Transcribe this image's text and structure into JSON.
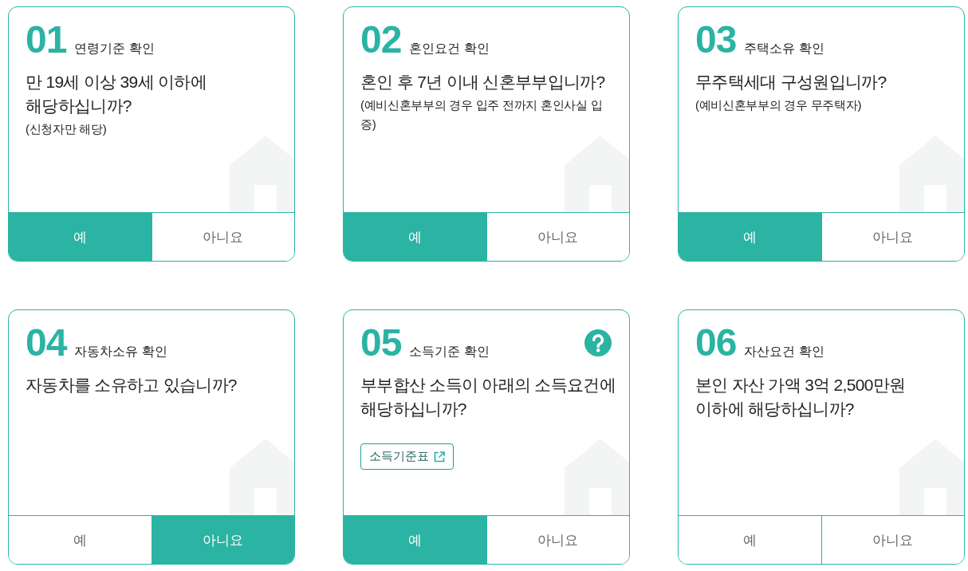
{
  "cards": [
    {
      "number": "01",
      "title": "연령기준 확인",
      "question": "만 19세 이상 39세 이하에 해당하십니까?",
      "note": "(신청자만 해당)",
      "answers": [
        {
          "label": "예",
          "selected": true
        },
        {
          "label": "아니요",
          "selected": false
        }
      ]
    },
    {
      "number": "02",
      "title": "혼인요건 확인",
      "question": "혼인 후 7년 이내 신혼부부입니까?",
      "note": "(예비신혼부부의 경우 입주 전까지 혼인사실 입증)",
      "answers": [
        {
          "label": "예",
          "selected": true
        },
        {
          "label": "아니요",
          "selected": false
        }
      ]
    },
    {
      "number": "03",
      "title": "주택소유 확인",
      "question": "무주택세대 구성원입니까?",
      "note": "(예비신혼부부의 경우 무주택자)",
      "answers": [
        {
          "label": "예",
          "selected": true
        },
        {
          "label": "아니요",
          "selected": false
        }
      ]
    },
    {
      "number": "04",
      "title": "자동차소유 확인",
      "question": "자동차를 소유하고 있습니까?",
      "answers": [
        {
          "label": "예",
          "selected": false
        },
        {
          "label": "아니요",
          "selected": true
        }
      ]
    },
    {
      "number": "05",
      "title": "소득기준 확인",
      "help_button": true,
      "question": "부부합산 소득이 아래의 소득요건에 해당하십니까?",
      "link": {
        "label": "소득기준표"
      },
      "answers": [
        {
          "label": "예",
          "selected": true
        },
        {
          "label": "아니요",
          "selected": false
        }
      ]
    },
    {
      "number": "06",
      "title": "자산요건 확인",
      "question": "본인 자산 가액 3억 2,500만원 이하에 해당하십니까?",
      "answers": [
        {
          "label": "예",
          "selected": false
        },
        {
          "label": "아니요",
          "selected": false
        }
      ]
    }
  ]
}
